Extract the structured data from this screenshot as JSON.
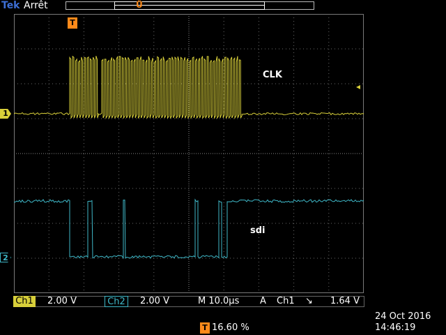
{
  "header": {
    "brand": "Tek",
    "mode": "Arrêt",
    "trigger_glyph": "Ů"
  },
  "markers": {
    "trigger_top": "T",
    "ch1": "1",
    "ch2": "2",
    "trigger_level": "◂"
  },
  "labels": {
    "clk": "CLK",
    "sdi": "sdi"
  },
  "status": {
    "ch1_label": "Ch1",
    "ch1_scale": "2.00 V",
    "ch2_label": "Ch2",
    "ch2_scale": "2.00 V",
    "timebase": "M 10.0µs",
    "trigger_mode": "A",
    "trigger_source": "Ch1",
    "trigger_slope": "↘",
    "trigger_level": "1.64 V"
  },
  "footer": {
    "position_icon": "T",
    "position_pct": "16.60 %",
    "date": "24 Oct  2016",
    "time": "14:46:19"
  },
  "colors": {
    "ch1": "#d8cf3a",
    "ch2": "#3fb8c8",
    "trigger": "#ff8a1a",
    "brand": "#3d6fd6",
    "grid": "#6a6a6a"
  }
}
